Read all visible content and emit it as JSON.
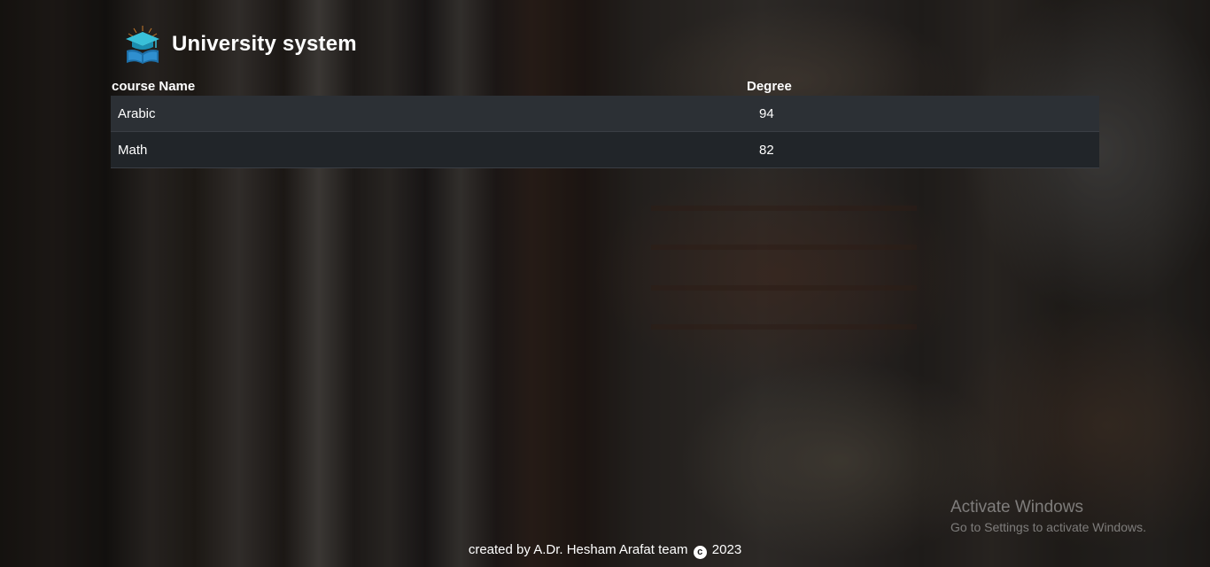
{
  "header": {
    "title": "University system",
    "logo_icon": "graduation-cap-books-icon"
  },
  "table": {
    "headers": [
      "course Name",
      "Degree"
    ],
    "rows": [
      {
        "course": "Arabic",
        "degree": "94"
      },
      {
        "course": "Math",
        "degree": "82"
      }
    ]
  },
  "footer": {
    "text_before": "created by A.Dr. Hesham Arafat team",
    "copyright_icon": "copyright-icon",
    "copyright_symbol": "c",
    "year": "2023"
  },
  "watermark": {
    "line1": "Activate Windows",
    "line2": "Go to Settings to activate Windows."
  },
  "colors": {
    "row_odd": "#2c3035",
    "row_even": "#212529",
    "text": "#ffffff"
  }
}
